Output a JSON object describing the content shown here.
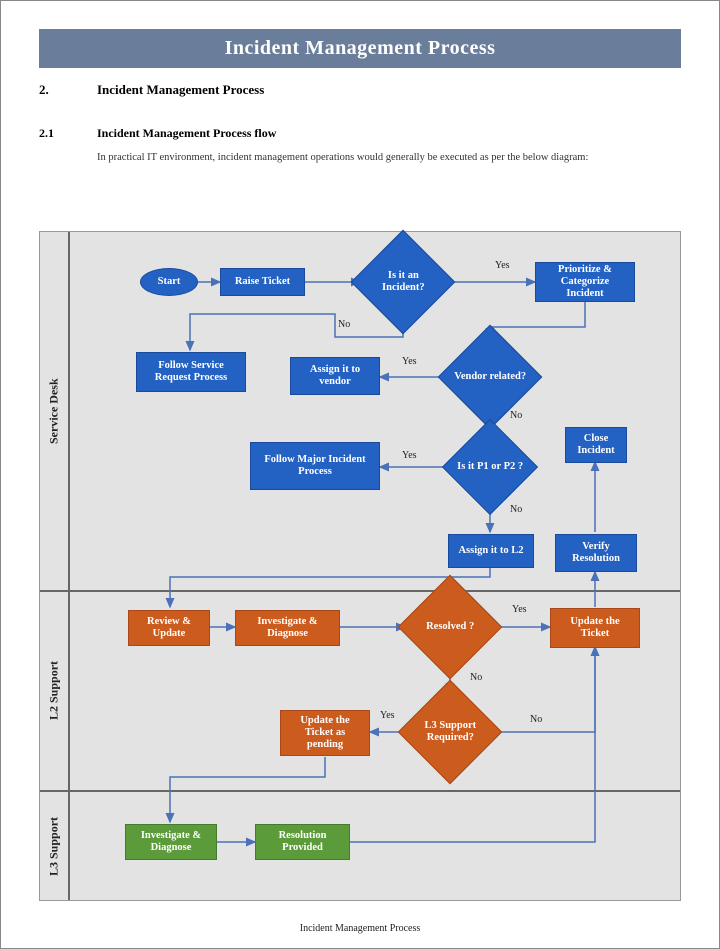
{
  "banner": "Incident Management Process",
  "section": {
    "num": "2.",
    "title": "Incident Management Process"
  },
  "subsection": {
    "num": "2.1",
    "title": "Incident Management Process flow"
  },
  "intro": "In practical IT environment, incident management operations would generally be executed as per the below diagram:",
  "footer": "Incident Management Process",
  "lanes": {
    "l1": "Service Desk",
    "l2": "L2 Support",
    "l3": "L3 Support"
  },
  "nodes": {
    "start": "Start",
    "raise": "Raise Ticket",
    "isIncident": "Is it an Incident?",
    "prioritize": "Prioritize & Categorize Incident",
    "followSR": "Follow Service Request Process",
    "assignVendor": "Assign it to vendor",
    "vendor": "Vendor related?",
    "followMajor": "Follow Major Incident Process",
    "isP1P2": "Is it P1 or P2 ?",
    "closeIncident": "Close Incident",
    "assignL2": "Assign it to L2",
    "verify": "Verify Resolution",
    "review": "Review & Update",
    "investigate2": "Investigate & Diagnose",
    "resolved": "Resolved ?",
    "updateTicket": "Update the Ticket",
    "updatePending": "Update the Ticket as pending",
    "l3req": "L3 Support Required?",
    "investigate3": "Investigate & Diagnose",
    "resolution": "Resolution Provided"
  },
  "labels": {
    "yes": "Yes",
    "no": "No"
  }
}
